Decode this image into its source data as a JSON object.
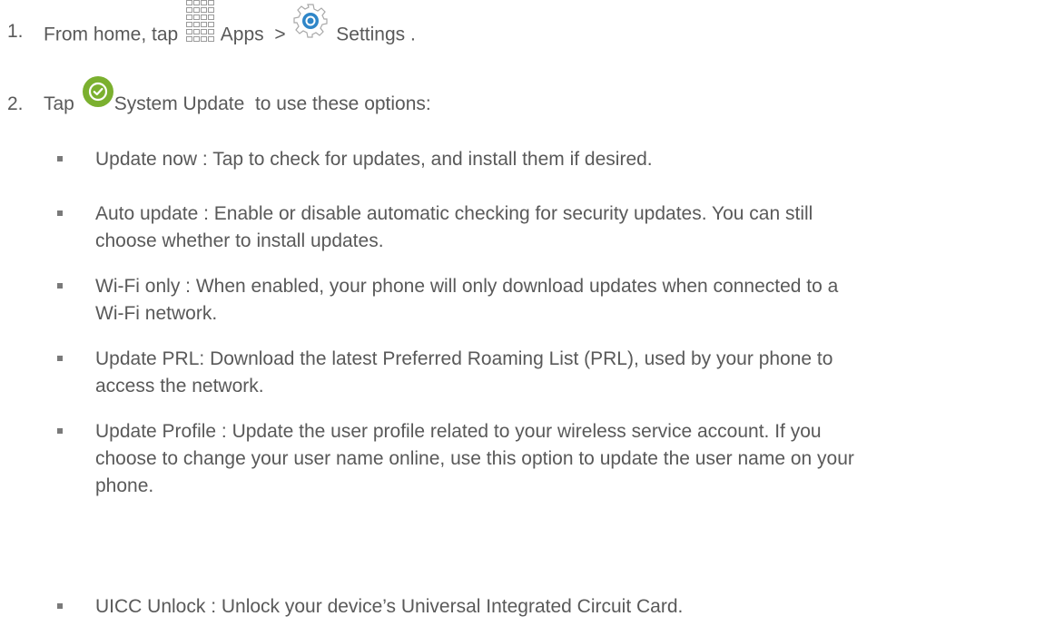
{
  "steps": [
    {
      "number": "1.",
      "text_before": "From home, tap",
      "icon1": "apps-grid-icon",
      "label1": "Apps",
      "separator": ">",
      "icon2": "settings-gear-icon",
      "label2": "Settings",
      "text_after": "."
    },
    {
      "number": "2.",
      "text_before": "Tap",
      "icon1": "system-update-check-icon",
      "label1": "System Update",
      "text_after": "to use these options:"
    }
  ],
  "options": [
    {
      "lines": [
        "Update now : Tap to check for updates, and install them if desired."
      ]
    },
    {
      "lines": [
        "Auto update : Enable or disable automatic checking for security updates. You can still",
        "choose whether to install updates."
      ]
    },
    {
      "lines": [
        "Wi-Fi only : When enabled, your phone will only download updates when connected to a",
        "Wi-Fi network."
      ]
    },
    {
      "lines": [
        "Update PRL: Download the latest Preferred Roaming List (PRL), used by your phone to",
        "access the network."
      ]
    },
    {
      "lines": [
        "Update Profile : Update the user profile related to your wireless service account. If you",
        "choose to change your user name online, use this option to update the user name on your",
        "phone."
      ]
    },
    {
      "lines": [
        "UICC Unlock : Unlock your device’s Universal Integrated Circuit Card."
      ]
    }
  ],
  "colors": {
    "text": "#595959",
    "check_icon": "#7bb02f",
    "gear_icon": "#2f86c8"
  }
}
